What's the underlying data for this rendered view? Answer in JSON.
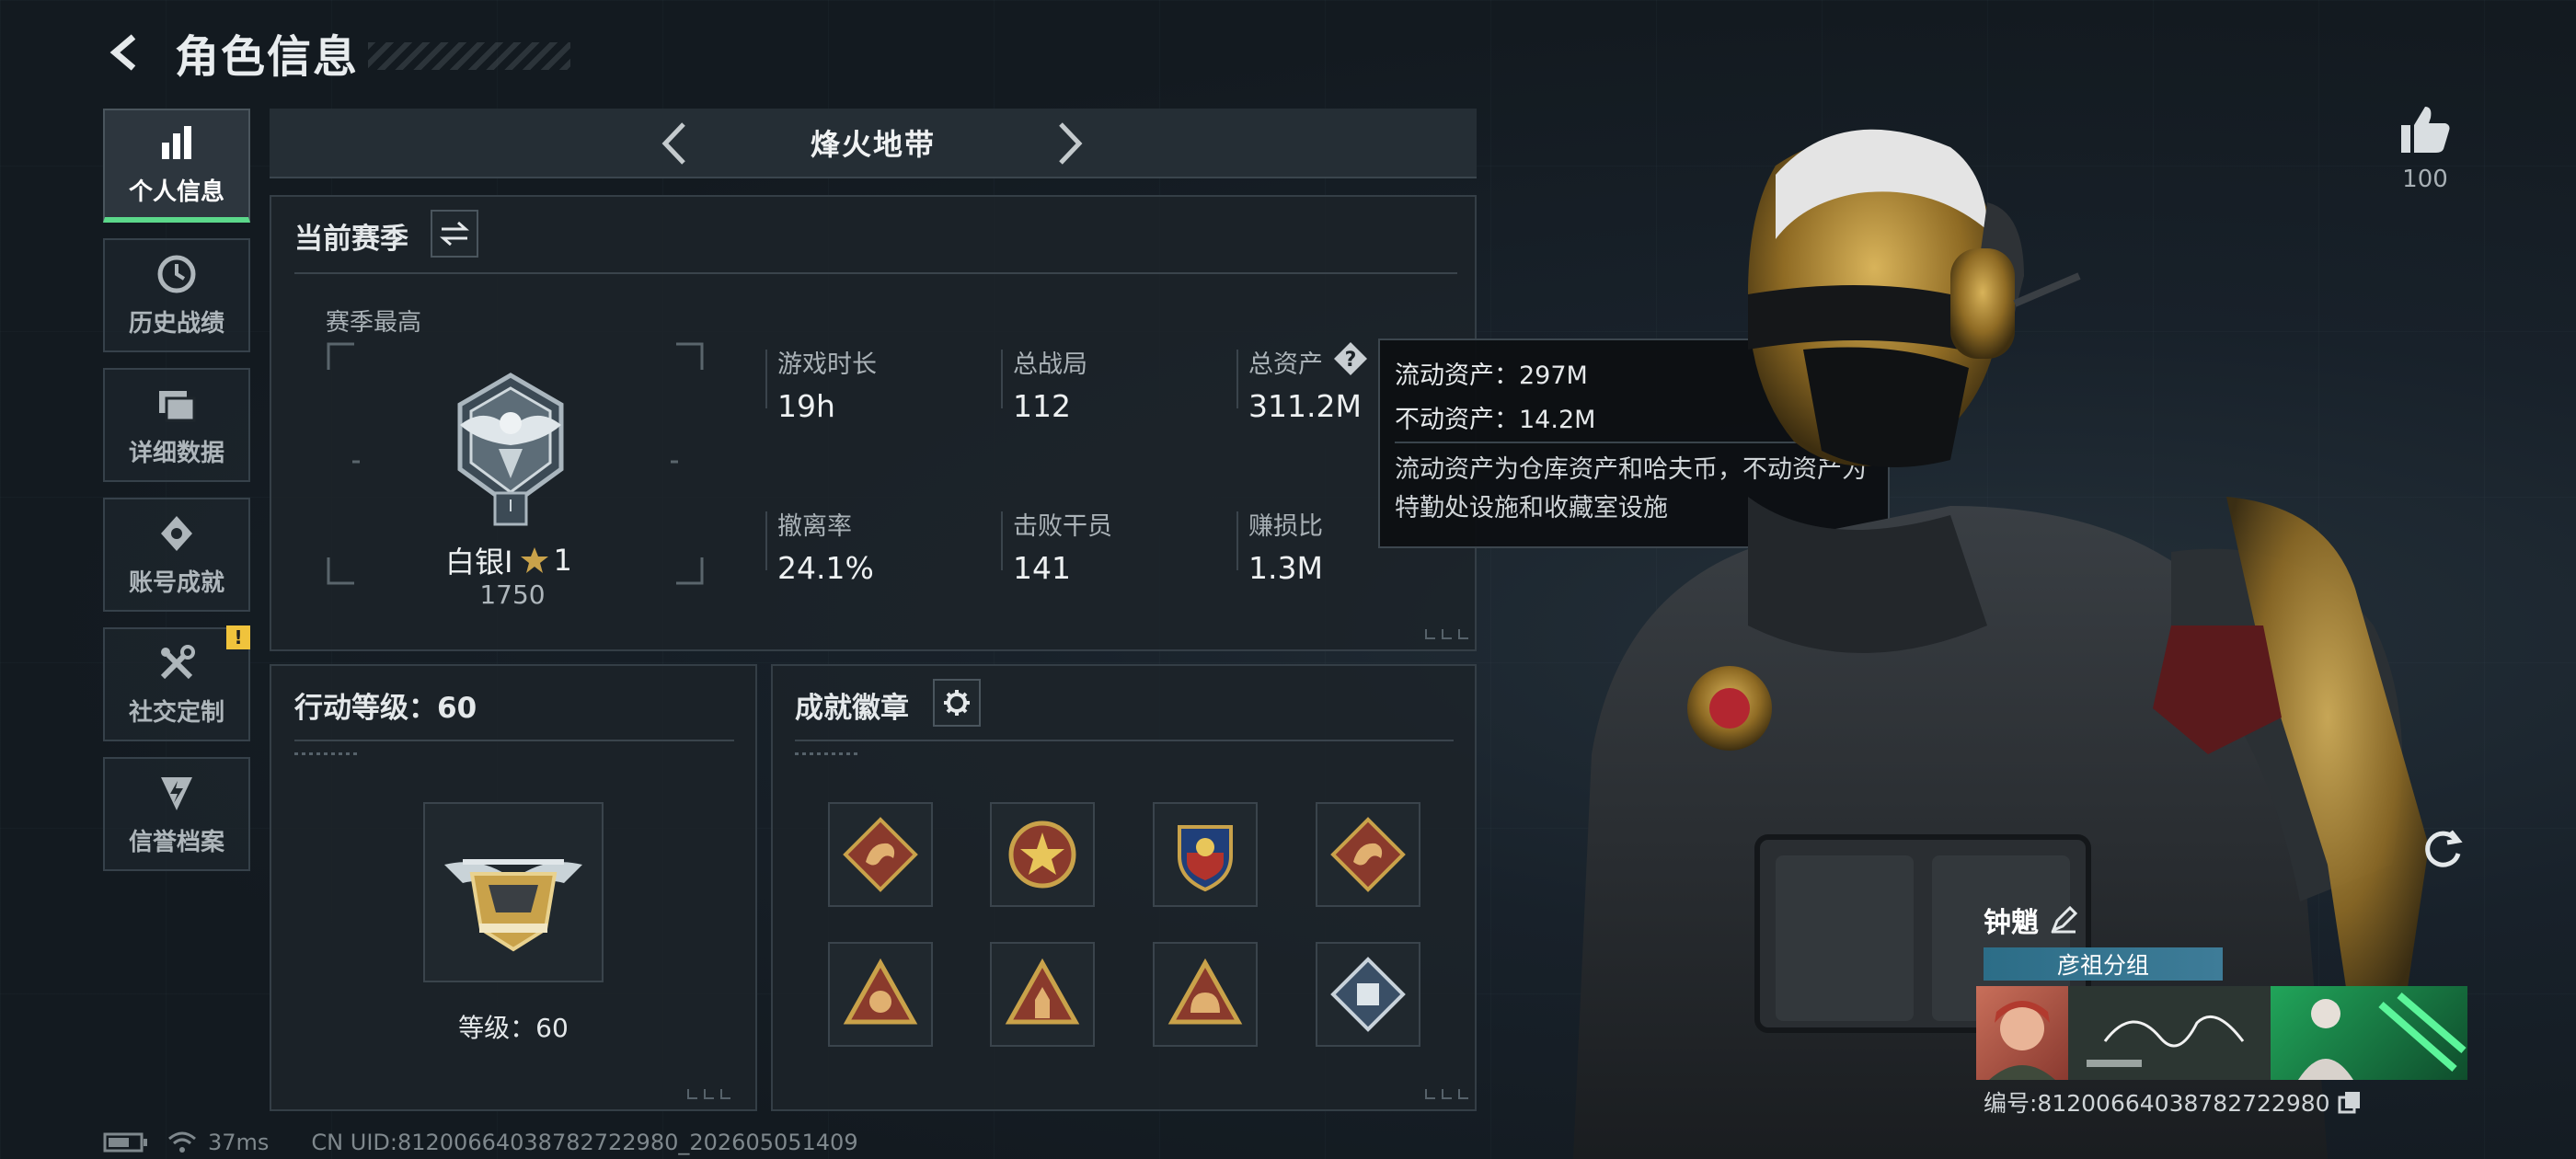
{
  "header": {
    "title": "角色信息"
  },
  "sidebar": {
    "items": [
      {
        "label": "个人信息",
        "icon": "bar-chart-icon",
        "active": true
      },
      {
        "label": "历史战绩",
        "icon": "clock-icon"
      },
      {
        "label": "详细数据",
        "icon": "folder-icon"
      },
      {
        "label": "账号成就",
        "icon": "achievement-icon"
      },
      {
        "label": "社交定制",
        "icon": "tools-icon",
        "badge": "!"
      },
      {
        "label": "信誉档案",
        "icon": "shield-bolt-icon"
      }
    ]
  },
  "season_nav": {
    "title": "烽火地带"
  },
  "current_season": {
    "title": "当前赛季",
    "best_label": "赛季最高",
    "rank_name": "白银I",
    "rank_stars": "1",
    "rank_points": "1750",
    "rank_numeral": "I",
    "stats": [
      {
        "label": "游戏时长",
        "value": "19h"
      },
      {
        "label": "总战局",
        "value": "112"
      },
      {
        "label": "总资产",
        "value": "311.2M"
      },
      {
        "label": "撤离率",
        "value": "24.1%"
      },
      {
        "label": "击败干员",
        "value": "141"
      },
      {
        "label": "赚损比",
        "value": "1.3M"
      }
    ]
  },
  "tooltip": {
    "liquid": "流动资产：297M",
    "fixed": "不动资产：14.2M",
    "note": "流动资产为仓库资产和哈夫币，不动资产为特勤处设施和收藏室设施"
  },
  "action_level": {
    "title": "行动等级：60",
    "level_text": "等级：60"
  },
  "achievements": {
    "title": "成就徽章",
    "badges": [
      "dragon-badge-icon",
      "star-badge-icon",
      "shield-badge-icon",
      "dragon-badge-icon",
      "triangle-badge-icon",
      "soldier-badge-icon",
      "helmet-badge-icon",
      "diamond-badge-icon"
    ]
  },
  "likes": {
    "count": "100"
  },
  "profile_card": {
    "name": "钟魈",
    "group": "彦祖分组",
    "id_text": "编号:81200664038782722980"
  },
  "footer": {
    "ping": "37ms",
    "uid": "CN UID:81200664038782722980_202605051409"
  },
  "colors": {
    "accent_green": "#5bd88a",
    "warn_yellow": "#f0c33c",
    "gold": "#c9a24a"
  }
}
